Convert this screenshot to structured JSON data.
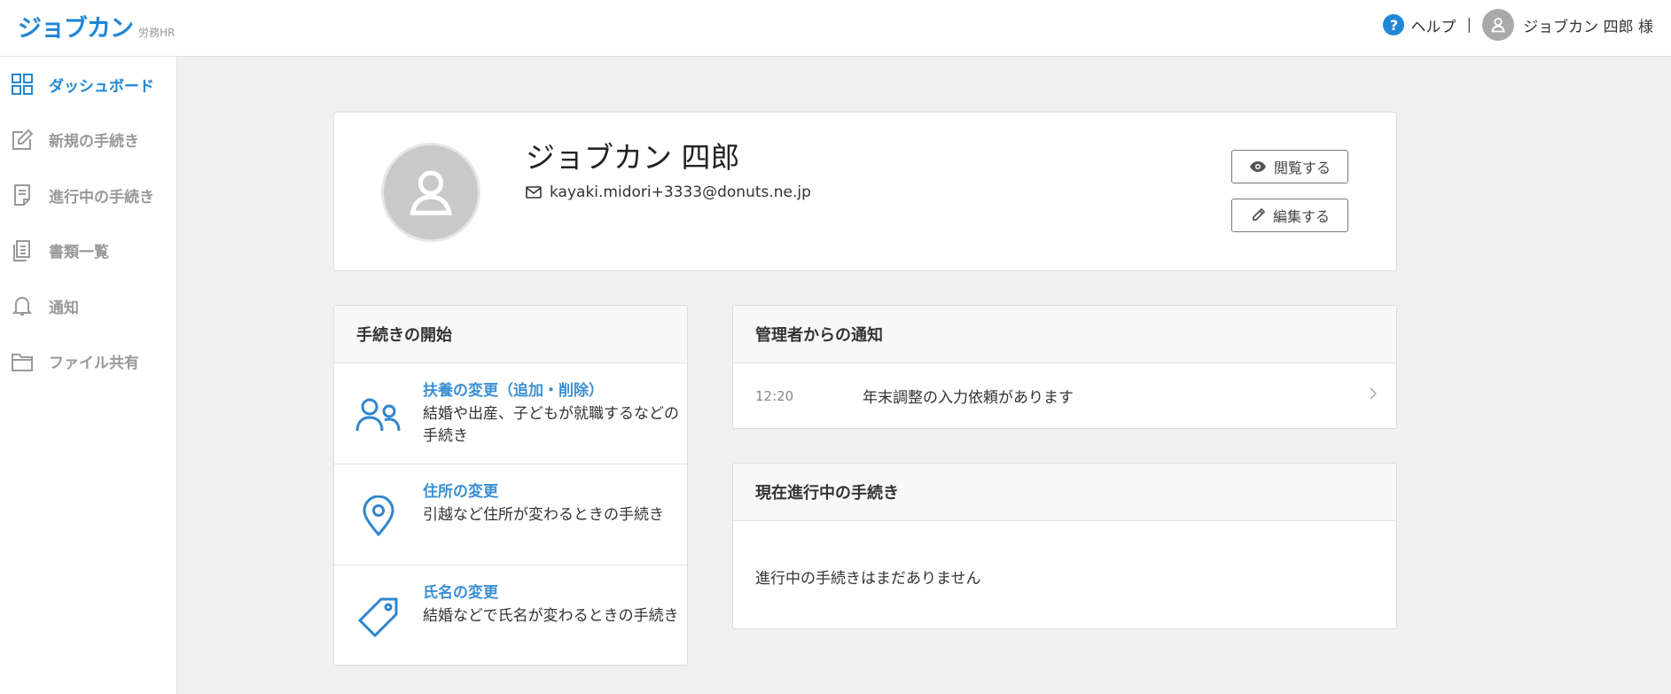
{
  "header": {
    "logo": "ジョブカン",
    "logo_sub": "労務HR",
    "help_label": "ヘルプ",
    "separator": "|",
    "user_name": "ジョブカン 四郎 様"
  },
  "sidebar": {
    "items": [
      {
        "label": "ダッシュボード",
        "icon": "grid-icon",
        "active": true
      },
      {
        "label": "新規の手続き",
        "icon": "edit-icon"
      },
      {
        "label": "進行中の手続き",
        "icon": "document-icon"
      },
      {
        "label": "書類一覧",
        "icon": "documents-icon"
      },
      {
        "label": "通知",
        "icon": "bell-icon"
      },
      {
        "label": "ファイル共有",
        "icon": "folder-icon"
      }
    ]
  },
  "profile": {
    "name": "ジョブカン 四郎",
    "email": "kayaki.midori+3333@donuts.ne.jp",
    "view_button": "閲覧する",
    "edit_button": "編集する"
  },
  "start_procedures": {
    "title": "手続きの開始",
    "items": [
      {
        "title": "扶養の変更（追加・削除）",
        "desc": "結婚や出産、子どもが就職するなどの手続き",
        "icon": "people-icon"
      },
      {
        "title": "住所の変更",
        "desc": "引越など住所が変わるときの手続き",
        "icon": "location-pin-icon"
      },
      {
        "title": "氏名の変更",
        "desc": "結婚などで氏名が変わるときの手続き",
        "icon": "tag-icon"
      }
    ]
  },
  "notices": {
    "title": "管理者からの通知",
    "items": [
      {
        "time": "12:20",
        "text": "年末調整の入力依頼があります"
      }
    ]
  },
  "in_progress": {
    "title": "現在進行中の手続き",
    "empty_text": "進行中の手続きはまだありません"
  },
  "colors": {
    "accent": "#1f87d6",
    "link": "#3b8fd4",
    "background": "#f0f0f0"
  }
}
